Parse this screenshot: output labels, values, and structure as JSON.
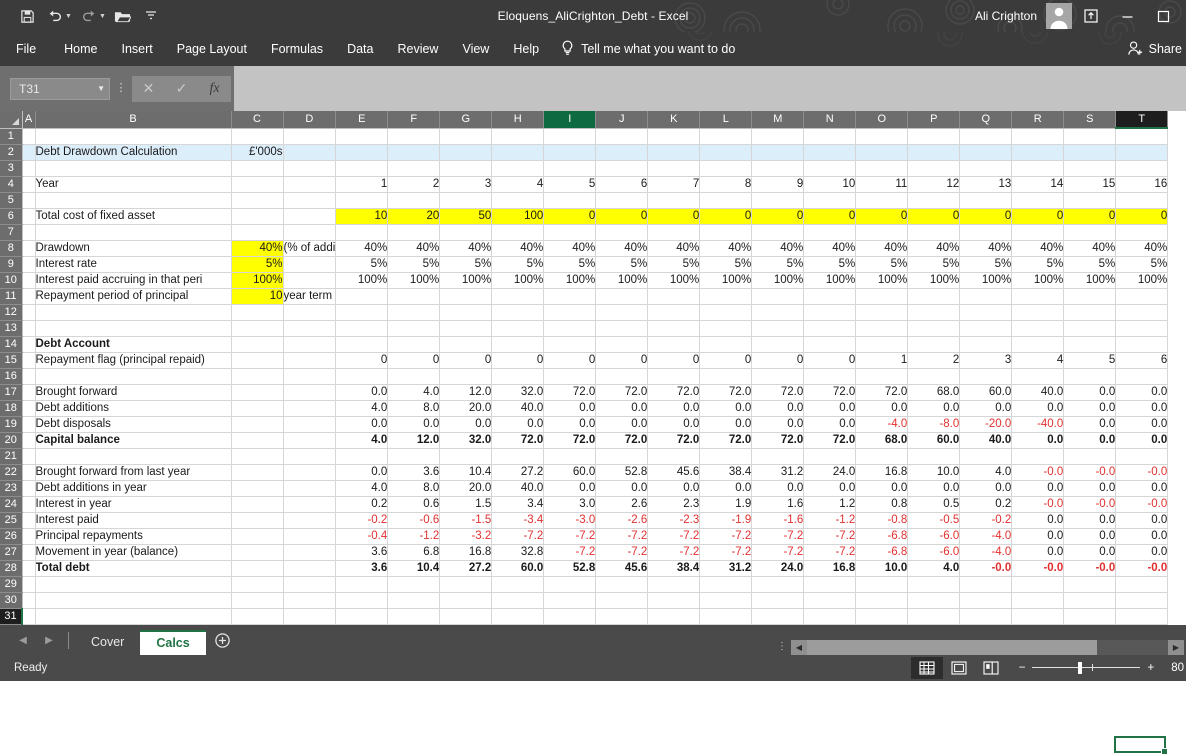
{
  "titlebar": {
    "document_title": "Eloquens_AliCrighton_Debt  -  Excel",
    "user_name": "Ali Crighton",
    "qat": [
      {
        "name": "save-icon",
        "label": "Save"
      },
      {
        "name": "undo-icon",
        "label": "Undo"
      },
      {
        "name": "redo-icon",
        "label": "Redo"
      },
      {
        "name": "open-icon",
        "label": "Open"
      },
      {
        "name": "customize-qat-icon",
        "label": "Customize Quick Access Toolbar"
      }
    ],
    "window_buttons": [
      {
        "name": "ribbon-display-options-icon",
        "glyph": "⇱"
      },
      {
        "name": "minimize-icon",
        "glyph": "—"
      },
      {
        "name": "restore-icon",
        "glyph": "▢"
      }
    ]
  },
  "ribbon": {
    "tabs": [
      "File",
      "Home",
      "Insert",
      "Page Layout",
      "Formulas",
      "Data",
      "Review",
      "View",
      "Help"
    ],
    "tellme_placeholder": "Tell me what you want to do",
    "share_label": "Share"
  },
  "formula_bar": {
    "name_box_value": "T31",
    "formula_value": "",
    "cancel_label": "✕",
    "enter_label": "✓",
    "fx_label": "fx"
  },
  "grid": {
    "columns": [
      "A",
      "B",
      "C",
      "D",
      "E",
      "F",
      "G",
      "H",
      "I",
      "J",
      "K",
      "L",
      "M",
      "N",
      "O",
      "P",
      "Q",
      "R",
      "S",
      "T"
    ],
    "selected_column": "T",
    "highlight_column": "I",
    "selected_row": 31,
    "active_cell": "T31",
    "rows": [
      {
        "n": 1,
        "cells": {}
      },
      {
        "n": 2,
        "band": "blu",
        "cells": {
          "B": "Debt Drawdown Calculation",
          "C": "£'000s"
        }
      },
      {
        "n": 3,
        "cells": {}
      },
      {
        "n": 4,
        "cells": {
          "B": "Year",
          "E": "1",
          "F": "2",
          "G": "3",
          "H": "4",
          "I": "5",
          "J": "6",
          "K": "7",
          "L": "8",
          "M": "9",
          "N": "10",
          "O": "11",
          "P": "12",
          "Q": "13",
          "R": "14",
          "S": "15",
          "T": "16"
        }
      },
      {
        "n": 5,
        "cells": {}
      },
      {
        "n": 6,
        "cells": {
          "B": "Total cost of fixed asset",
          "E": "10",
          "F": "20",
          "G": "50",
          "H": "100",
          "I": "0",
          "J": "0",
          "K": "0",
          "L": "0",
          "M": "0",
          "N": "0",
          "O": "0",
          "P": "0",
          "Q": "0",
          "R": "0",
          "S": "0",
          "T": "0"
        }
      },
      {
        "n": 7,
        "cells": {}
      },
      {
        "n": 8,
        "cells": {
          "B": "Drawdown",
          "C": "40%",
          "D": "(% of addi",
          "E": "40%",
          "F": "40%",
          "G": "40%",
          "H": "40%",
          "I": "40%",
          "J": "40%",
          "K": "40%",
          "L": "40%",
          "M": "40%",
          "N": "40%",
          "O": "40%",
          "P": "40%",
          "Q": "40%",
          "R": "40%",
          "S": "40%",
          "T": "40%"
        }
      },
      {
        "n": 9,
        "cells": {
          "B": "Interest rate",
          "C": "5%",
          "E": "5%",
          "F": "5%",
          "G": "5%",
          "H": "5%",
          "I": "5%",
          "J": "5%",
          "K": "5%",
          "L": "5%",
          "M": "5%",
          "N": "5%",
          "O": "5%",
          "P": "5%",
          "Q": "5%",
          "R": "5%",
          "S": "5%",
          "T": "5%"
        }
      },
      {
        "n": 10,
        "cells": {
          "B": "Interest paid accruing in that peri",
          "C": "100%",
          "E": "100%",
          "F": "100%",
          "G": "100%",
          "H": "100%",
          "I": "100%",
          "J": "100%",
          "K": "100%",
          "L": "100%",
          "M": "100%",
          "N": "100%",
          "O": "100%",
          "P": "100%",
          "Q": "100%",
          "R": "100%",
          "S": "100%",
          "T": "100%"
        }
      },
      {
        "n": 11,
        "cells": {
          "B": "Repayment period of principal",
          "C": "10",
          "D": "year term"
        }
      },
      {
        "n": 12,
        "cells": {}
      },
      {
        "n": 13,
        "cells": {}
      },
      {
        "n": 14,
        "cells": {
          "B": "Debt Account"
        }
      },
      {
        "n": 15,
        "cells": {
          "B": "Repayment flag (principal repaid)",
          "E": "0",
          "F": "0",
          "G": "0",
          "H": "0",
          "I": "0",
          "J": "0",
          "K": "0",
          "L": "0",
          "M": "0",
          "N": "0",
          "O": "1",
          "P": "2",
          "Q": "3",
          "R": "4",
          "S": "5",
          "T": "6"
        }
      },
      {
        "n": 16,
        "cells": {}
      },
      {
        "n": 17,
        "cells": {
          "B": "Brought forward",
          "E": "0.0",
          "F": "4.0",
          "G": "12.0",
          "H": "32.0",
          "I": "72.0",
          "J": "72.0",
          "K": "72.0",
          "L": "72.0",
          "M": "72.0",
          "N": "72.0",
          "O": "72.0",
          "P": "68.0",
          "Q": "60.0",
          "R": "40.0",
          "S": "0.0",
          "T": "0.0"
        }
      },
      {
        "n": 18,
        "cells": {
          "B": "Debt additions",
          "E": "4.0",
          "F": "8.0",
          "G": "20.0",
          "H": "40.0",
          "I": "0.0",
          "J": "0.0",
          "K": "0.0",
          "L": "0.0",
          "M": "0.0",
          "N": "0.0",
          "O": "0.0",
          "P": "0.0",
          "Q": "0.0",
          "R": "0.0",
          "S": "0.0",
          "T": "0.0"
        }
      },
      {
        "n": 19,
        "cells": {
          "B": "Debt disposals",
          "E": "0.0",
          "F": "0.0",
          "G": "0.0",
          "H": "0.0",
          "I": "0.0",
          "J": "0.0",
          "K": "0.0",
          "L": "0.0",
          "M": "0.0",
          "N": "0.0",
          "O": "-4.0",
          "P": "-8.0",
          "Q": "-20.0",
          "R": "-40.0",
          "S": "0.0",
          "T": "0.0"
        }
      },
      {
        "n": 20,
        "cells": {
          "B": "Capital balance",
          "E": "4.0",
          "F": "12.0",
          "G": "32.0",
          "H": "72.0",
          "I": "72.0",
          "J": "72.0",
          "K": "72.0",
          "L": "72.0",
          "M": "72.0",
          "N": "72.0",
          "O": "68.0",
          "P": "60.0",
          "Q": "40.0",
          "R": "0.0",
          "S": "0.0",
          "T": "0.0"
        }
      },
      {
        "n": 21,
        "cells": {}
      },
      {
        "n": 22,
        "cells": {
          "B": "Brought forward from last year",
          "E": "0.0",
          "F": "3.6",
          "G": "10.4",
          "H": "27.2",
          "I": "60.0",
          "J": "52.8",
          "K": "45.6",
          "L": "38.4",
          "M": "31.2",
          "N": "24.0",
          "O": "16.8",
          "P": "10.0",
          "Q": "4.0",
          "R": "-0.0",
          "S": "-0.0",
          "T": "-0.0"
        }
      },
      {
        "n": 23,
        "cells": {
          "B": "Debt additions in year",
          "E": "4.0",
          "F": "8.0",
          "G": "20.0",
          "H": "40.0",
          "I": "0.0",
          "J": "0.0",
          "K": "0.0",
          "L": "0.0",
          "M": "0.0",
          "N": "0.0",
          "O": "0.0",
          "P": "0.0",
          "Q": "0.0",
          "R": "0.0",
          "S": "0.0",
          "T": "0.0"
        }
      },
      {
        "n": 24,
        "cells": {
          "B": "Interest in year",
          "E": "0.2",
          "F": "0.6",
          "G": "1.5",
          "H": "3.4",
          "I": "3.0",
          "J": "2.6",
          "K": "2.3",
          "L": "1.9",
          "M": "1.6",
          "N": "1.2",
          "O": "0.8",
          "P": "0.5",
          "Q": "0.2",
          "R": "-0.0",
          "S": "-0.0",
          "T": "-0.0"
        }
      },
      {
        "n": 25,
        "cells": {
          "B": "Interest paid",
          "E": "-0.2",
          "F": "-0.6",
          "G": "-1.5",
          "H": "-3.4",
          "I": "-3.0",
          "J": "-2.6",
          "K": "-2.3",
          "L": "-1.9",
          "M": "-1.6",
          "N": "-1.2",
          "O": "-0.8",
          "P": "-0.5",
          "Q": "-0.2",
          "R": "0.0",
          "S": "0.0",
          "T": "0.0"
        }
      },
      {
        "n": 26,
        "cells": {
          "B": "Principal repayments",
          "E": "-0.4",
          "F": "-1.2",
          "G": "-3.2",
          "H": "-7.2",
          "I": "-7.2",
          "J": "-7.2",
          "K": "-7.2",
          "L": "-7.2",
          "M": "-7.2",
          "N": "-7.2",
          "O": "-6.8",
          "P": "-6.0",
          "Q": "-4.0",
          "R": "0.0",
          "S": "0.0",
          "T": "0.0"
        }
      },
      {
        "n": 27,
        "cells": {
          "B": "Movement in year (balance)",
          "E": "3.6",
          "F": "6.8",
          "G": "16.8",
          "H": "32.8",
          "I": "-7.2",
          "J": "-7.2",
          "K": "-7.2",
          "L": "-7.2",
          "M": "-7.2",
          "N": "-7.2",
          "O": "-6.8",
          "P": "-6.0",
          "Q": "-4.0",
          "R": "0.0",
          "S": "0.0",
          "T": "0.0"
        }
      },
      {
        "n": 28,
        "cells": {
          "B": "Total debt",
          "E": "3.6",
          "F": "10.4",
          "G": "27.2",
          "H": "60.0",
          "I": "52.8",
          "J": "45.6",
          "K": "38.4",
          "L": "31.2",
          "M": "24.0",
          "N": "16.8",
          "O": "10.0",
          "P": "4.0",
          "Q": "-0.0",
          "R": "-0.0",
          "S": "-0.0",
          "T": "-0.0"
        }
      },
      {
        "n": 29,
        "cells": {}
      },
      {
        "n": 30,
        "cells": {}
      },
      {
        "n": 31,
        "cells": {}
      }
    ]
  },
  "sheet_tabs": {
    "tabs": [
      {
        "label": "Cover",
        "active": false
      },
      {
        "label": "Calcs",
        "active": true
      }
    ],
    "add_sheet_label": "+",
    "prev_label": "◀",
    "next_label": "▶"
  },
  "status_bar": {
    "state": "Ready",
    "views": [
      {
        "name": "normal-view-icon",
        "active": true
      },
      {
        "name": "page-layout-view-icon",
        "active": false
      },
      {
        "name": "page-break-preview-icon",
        "active": false
      }
    ],
    "zoom_out_label": "−",
    "zoom_in_label": "+",
    "zoom_value": "80"
  }
}
